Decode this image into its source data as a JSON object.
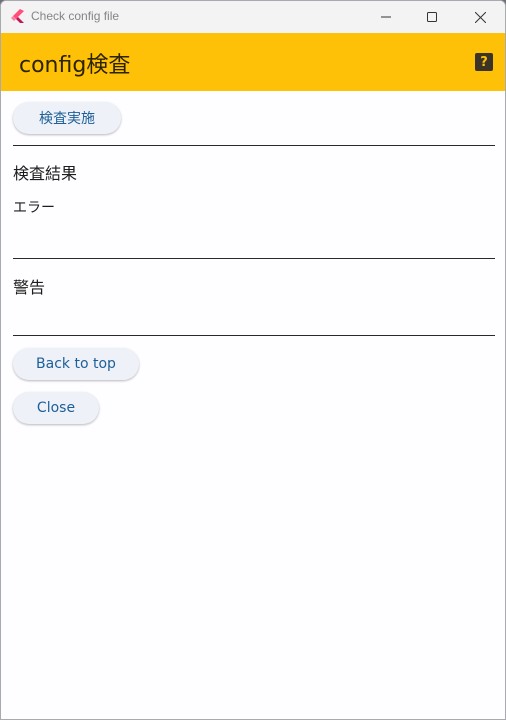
{
  "window": {
    "title": "Check config file"
  },
  "appbar": {
    "title": "config検査",
    "help_label": "?"
  },
  "actions": {
    "run_label": "検査実施",
    "back_label": "Back to top",
    "close_label": "Close"
  },
  "results": {
    "heading": "検査結果",
    "errors_label": "エラー",
    "warnings_label": "警告"
  },
  "colors": {
    "appbar": "#ffc107",
    "button_text": "#1d5f98",
    "button_bg": "#eef1f8"
  }
}
